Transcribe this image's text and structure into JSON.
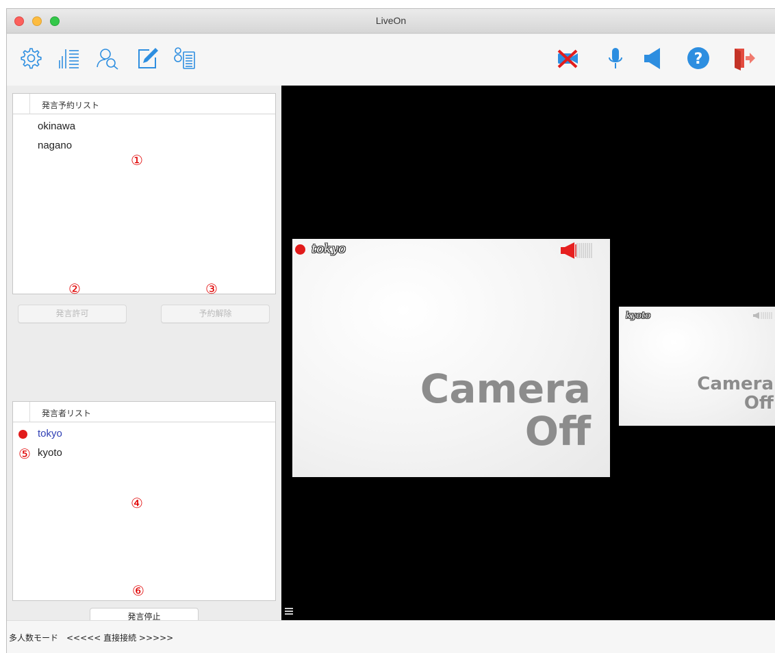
{
  "window": {
    "title": "LiveOn"
  },
  "toolbar": {
    "left_icons": [
      "gear-icon",
      "equalizer-list-icon",
      "search-user-icon",
      "edit-pen-icon",
      "participants-list-icon"
    ],
    "right_icons": [
      "camera-off-icon",
      "microphone-icon",
      "speaker-icon",
      "help-icon",
      "exit-door-icon"
    ]
  },
  "reservation_list": {
    "header": "発言予約リスト",
    "items": [
      "okinawa",
      "nagano"
    ]
  },
  "buttons": {
    "allow_speech": "発言許可",
    "cancel_reservation": "予約解除",
    "stop_speech": "発言停止"
  },
  "speaker_list": {
    "header": "発言者リスト",
    "items": [
      {
        "name": "tokyo",
        "active": true
      },
      {
        "name": "kyoto",
        "active": false
      }
    ]
  },
  "annotations": [
    "①",
    "②",
    "③",
    "④",
    "⑤",
    "⑥"
  ],
  "video": {
    "tiles": [
      {
        "name": "tokyo",
        "status_line1": "Camera",
        "status_line2": "Off",
        "recording": true
      },
      {
        "name": "kyoto",
        "status_line1": "Camera",
        "status_line2": "Off",
        "recording": false
      }
    ]
  },
  "status_bar": {
    "text": "多人数モード　<<<<< 直接接続 >>>>>"
  },
  "colors": {
    "record_red": "#e11b1b",
    "accent_blue": "#2d8ee0",
    "annotation_red": "#e00000",
    "active_speaker": "#2f3fb4"
  }
}
